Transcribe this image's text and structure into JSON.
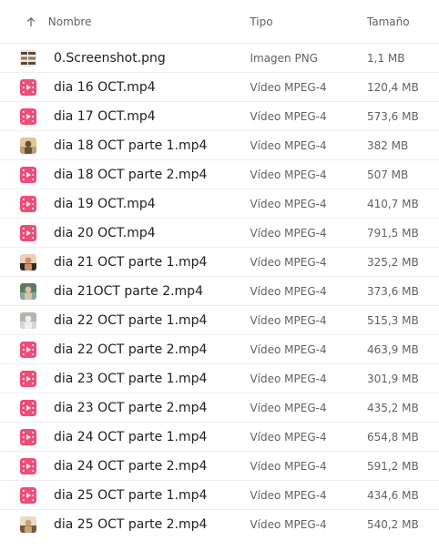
{
  "columns": {
    "name": "Nombre",
    "type": "Tipo",
    "size": "Tamaño"
  },
  "accent": "#ee4d79",
  "files": [
    {
      "name": "0.Screenshot.png",
      "type": "Imagen PNG",
      "size": "1,1 MB",
      "icon": "image-thumbnail-icon"
    },
    {
      "name": "dia 16 OCT.mp4",
      "type": "Vídeo MPEG-4",
      "size": "120,4 MB",
      "icon": "video-file-icon"
    },
    {
      "name": "dia 17 OCT.mp4",
      "type": "Vídeo MPEG-4",
      "size": "573,6 MB",
      "icon": "video-file-icon"
    },
    {
      "name": "dia 18 OCT parte 1.mp4",
      "type": "Vídeo MPEG-4",
      "size": "382 MB",
      "icon": "video-thumbnail-icon"
    },
    {
      "name": "dia 18 OCT parte 2.mp4",
      "type": "Vídeo MPEG-4",
      "size": "507 MB",
      "icon": "video-file-icon"
    },
    {
      "name": "dia 19 OCT.mp4",
      "type": "Vídeo MPEG-4",
      "size": "410,7 MB",
      "icon": "video-file-icon"
    },
    {
      "name": "dia 20 OCT.mp4",
      "type": "Vídeo MPEG-4",
      "size": "791,5 MB",
      "icon": "video-file-icon"
    },
    {
      "name": "dia 21 OCT parte 1.mp4",
      "type": "Vídeo MPEG-4",
      "size": "325,2 MB",
      "icon": "video-thumbnail-icon"
    },
    {
      "name": "dia 21OCT parte 2.mp4",
      "type": "Vídeo MPEG-4",
      "size": "373,6 MB",
      "icon": "video-thumbnail-icon"
    },
    {
      "name": "dia 22 OCT parte 1.mp4",
      "type": "Vídeo MPEG-4",
      "size": "515,3 MB",
      "icon": "video-thumbnail-icon"
    },
    {
      "name": "dia 22 OCT parte 2.mp4",
      "type": "Vídeo MPEG-4",
      "size": "463,9 MB",
      "icon": "video-file-icon"
    },
    {
      "name": "dia 23 OCT parte 1.mp4",
      "type": "Vídeo MPEG-4",
      "size": "301,9 MB",
      "icon": "video-file-icon"
    },
    {
      "name": "dia 23 OCT parte 2.mp4",
      "type": "Vídeo MPEG-4",
      "size": "435,2 MB",
      "icon": "video-file-icon"
    },
    {
      "name": "dia 24 OCT parte 1.mp4",
      "type": "Vídeo MPEG-4",
      "size": "654,8 MB",
      "icon": "video-file-icon"
    },
    {
      "name": "dia 24 OCT parte 2.mp4",
      "type": "Vídeo MPEG-4",
      "size": "591,2 MB",
      "icon": "video-file-icon"
    },
    {
      "name": "dia 25 OCT parte 1.mp4",
      "type": "Vídeo MPEG-4",
      "size": "434,6 MB",
      "icon": "video-file-icon"
    },
    {
      "name": "dia 25 OCT parte 2.mp4",
      "type": "Vídeo MPEG-4",
      "size": "540,2 MB",
      "icon": "video-thumbnail-icon"
    }
  ]
}
